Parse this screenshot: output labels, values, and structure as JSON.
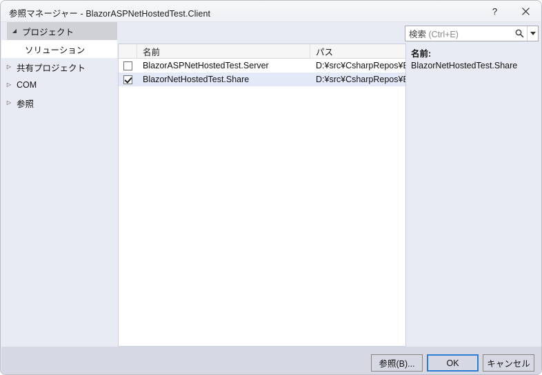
{
  "window": {
    "title": "参照マネージャー - BlazorASPNetHostedTest.Client",
    "help_label": "?",
    "close_label": "✕"
  },
  "sidebar": {
    "items": [
      {
        "label": "プロジェクト",
        "arrow": "◢",
        "expanded": true,
        "selected": true
      },
      {
        "label": "ソリューション",
        "arrow": "",
        "expanded": false,
        "selected": false,
        "child": true
      },
      {
        "label": "共有プロジェクト",
        "arrow": "▷",
        "expanded": false,
        "selected": false
      },
      {
        "label": "COM",
        "arrow": "▷",
        "expanded": false,
        "selected": false
      },
      {
        "label": "参照",
        "arrow": "▷",
        "expanded": false,
        "selected": false
      }
    ]
  },
  "search": {
    "placeholder_primary": "検索",
    "placeholder_hint": " (Ctrl+E)",
    "icon": "search-icon",
    "dropdown_icon": "chevron-down-icon"
  },
  "list": {
    "columns": [
      {
        "key": "check",
        "label": ""
      },
      {
        "key": "name",
        "label": "名前"
      },
      {
        "key": "path",
        "label": "パス"
      }
    ],
    "rows": [
      {
        "checked": false,
        "name": "BlazorASPNetHostedTest.Server",
        "path": "D:¥src¥CsharpRepos¥B...",
        "selected": false
      },
      {
        "checked": true,
        "name": "BlazorNetHostedTest.Share",
        "path": "D:¥src¥CsharpRepos¥B...",
        "selected": true
      }
    ]
  },
  "detail": {
    "label": "名前:",
    "value": "BlazorNetHostedTest.Share"
  },
  "footer": {
    "browse_label": "参照(B)...",
    "ok_label": "OK",
    "cancel_label": "キャンセル"
  },
  "colors": {
    "window_bg": "#e9ebf4",
    "titlebar_bg": "#f3f4f8",
    "sidebar_bg": "#e9ebf4",
    "sidebar_selected": "#d0d0d7",
    "sidebar_active_child": "#ffffff",
    "list_bg": "#ffffff",
    "list_header_bg": "#f6f6f6",
    "row_selected": "#e4e9f8",
    "footer_bg": "#d6d9e4",
    "default_button_border": "#2f7cd6",
    "border": "#cdd0dc"
  }
}
